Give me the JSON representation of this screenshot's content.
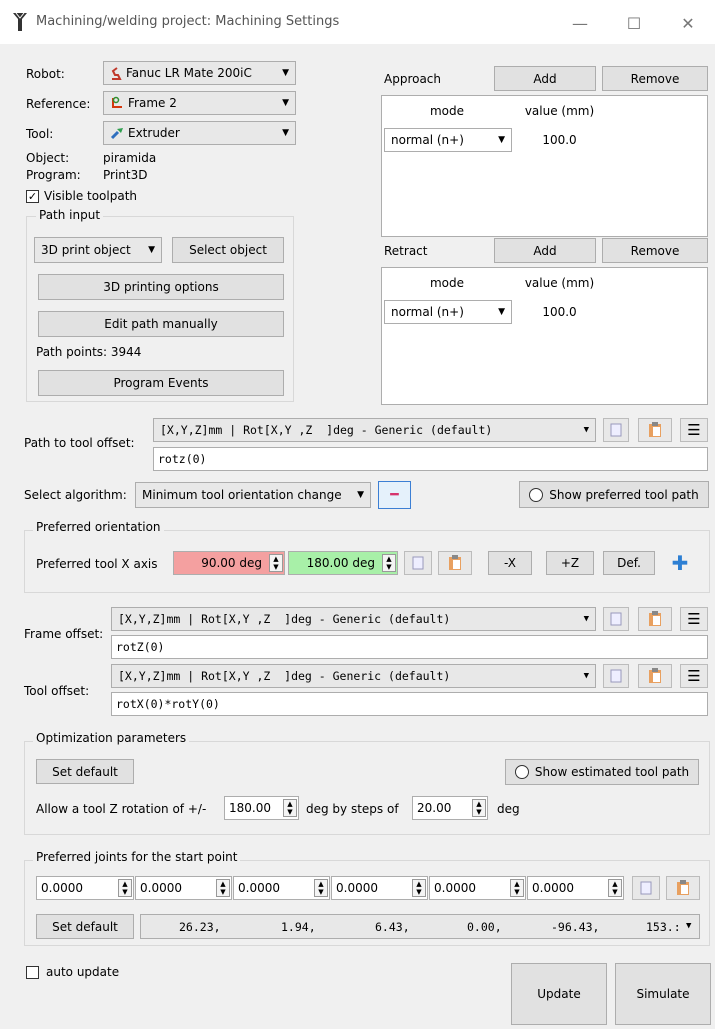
{
  "window": {
    "title": "Machining/welding project: Machining Settings",
    "minimize": "—",
    "maximize": "☐",
    "close": "✕"
  },
  "robot": {
    "label": "Robot:",
    "value": "Fanuc LR Mate 200iC"
  },
  "reference": {
    "label": "Reference:",
    "value": "Frame 2"
  },
  "tool": {
    "label": "Tool:",
    "value": "Extruder"
  },
  "object": {
    "label": "Object:",
    "value": "piramida"
  },
  "program": {
    "label": "Program:",
    "value": "Print3D"
  },
  "visible_toolpath": {
    "label": "Visible toolpath",
    "checked": true
  },
  "path_input": {
    "title": "Path input",
    "type_value": "3D print object",
    "select_object": "Select object",
    "printing_options": "3D printing options",
    "edit_path": "Edit path manually",
    "path_points": "Path points: 3944",
    "program_events": "Program Events"
  },
  "approach": {
    "label": "Approach",
    "add": "Add",
    "remove": "Remove",
    "col_mode": "mode",
    "col_value": "value (mm)",
    "row_mode": "normal (n+)",
    "row_value": "100.0"
  },
  "retract": {
    "label": "Retract",
    "add": "Add",
    "remove": "Remove",
    "col_mode": "mode",
    "col_value": "value (mm)",
    "row_mode": "normal (n+)",
    "row_value": "100.0"
  },
  "path_to_tool_offset": {
    "label": "Path to tool offset:",
    "format": "[X,Y,Z]mm | Rot[X,Y ,Z  ]deg - Generic (default)",
    "value": "rotz(0)"
  },
  "algorithm": {
    "label": "Select algorithm:",
    "value": "Minimum tool orientation change",
    "remove_symbol": "━",
    "show_preferred": "Show preferred tool path"
  },
  "preferred_orientation": {
    "title": "Preferred orientation",
    "label": "Preferred tool X axis",
    "value1": "90.00 deg",
    "value2": "180.00 deg",
    "btn_mx": "-X",
    "btn_pz": "+Z",
    "btn_def": "Def.",
    "add_symbol": "✚",
    "color1": "#f4a0a0",
    "color2": "#a8f0a8"
  },
  "frame_offset": {
    "label": "Frame offset:",
    "format": "[X,Y,Z]mm | Rot[X,Y ,Z  ]deg - Generic (default)",
    "value": "rotZ(0)"
  },
  "tool_offset": {
    "label": "Tool offset:",
    "format": "[X,Y,Z]mm | Rot[X,Y ,Z  ]deg - Generic (default)",
    "value": "rotX(0)*rotY(0)"
  },
  "optimization": {
    "title": "Optimization parameters",
    "set_default": "Set default",
    "show_estimated": "Show estimated tool path",
    "allow_label": "Allow a tool Z rotation of +/-",
    "rotation_value": "180.00",
    "steps_label": "deg by steps of",
    "step_value": "20.00",
    "deg_label": "deg"
  },
  "preferred_joints": {
    "title": "Preferred joints for the start point",
    "joints": [
      "0.0000",
      "0.0000",
      "0.0000",
      "0.0000",
      "0.0000",
      "0.0000"
    ],
    "set_default": "Set default",
    "current": [
      "26.23,",
      "1.94,",
      "6.43,",
      "0.00,",
      "-96.43,",
      "153.:"
    ]
  },
  "auto_update": {
    "label": "auto update",
    "checked": false
  },
  "update_button": "Update",
  "simulate_button": "Simulate",
  "icons": {
    "hamburger": "☰",
    "dropdown_arrow": "▼",
    "spin_up": "▲",
    "spin_down": "▼",
    "check": "✓"
  }
}
